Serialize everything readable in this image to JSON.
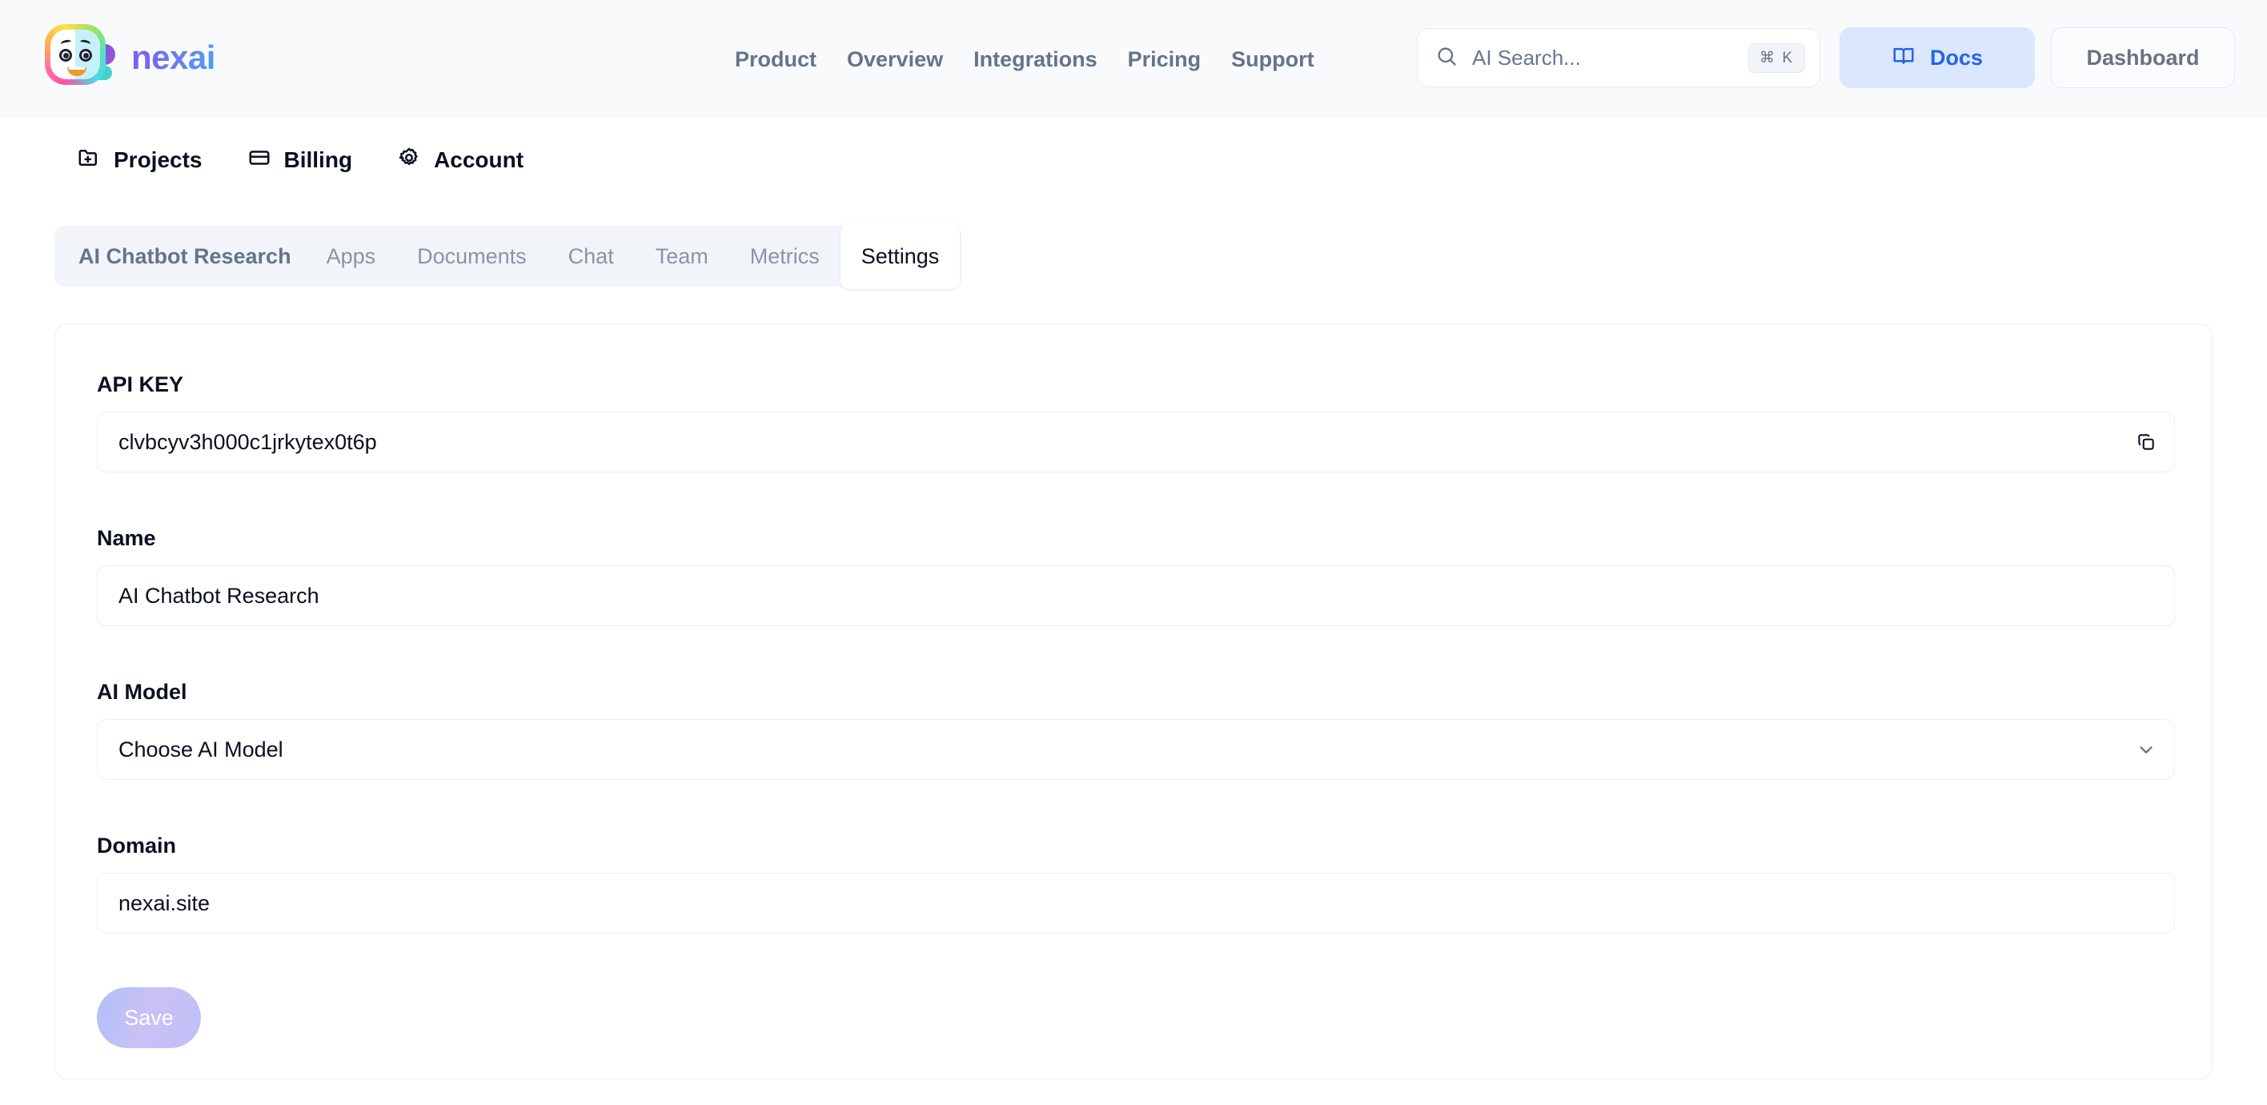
{
  "header": {
    "brand_name": "nexai",
    "nav_links": [
      "Product",
      "Overview",
      "Integrations",
      "Pricing",
      "Support"
    ],
    "search": {
      "placeholder": "AI Search...",
      "shortcut": "⌘ K"
    },
    "docs_label": "Docs",
    "dashboard_label": "Dashboard",
    "accent_blue": "#2563eb",
    "docs_bg": "#dbe7fd",
    "bar_bg": "#f8fafc"
  },
  "subnav": {
    "items": [
      {
        "label": "Projects",
        "icon": "folder-plus-icon"
      },
      {
        "label": "Billing",
        "icon": "credit-card-icon"
      },
      {
        "label": "Account",
        "icon": "gear-icon"
      }
    ]
  },
  "tabs": {
    "project_title": "AI Chatbot Research",
    "items": [
      "Apps",
      "Documents",
      "Chat",
      "Team",
      "Metrics",
      "Settings"
    ],
    "active": "Settings",
    "strip_bg": "#f1f5fa"
  },
  "settings_form": {
    "fields": [
      {
        "key": "api_key",
        "label": "API KEY",
        "value": "clvbcyv3h000c1jrkytex0t6p",
        "trailing_icon": "copy-icon"
      },
      {
        "key": "name",
        "label": "Name",
        "value": "AI Chatbot Research",
        "trailing_icon": ""
      },
      {
        "key": "ai_model",
        "label": "AI Model",
        "value": "Choose AI Model",
        "trailing_icon": "chevron-down-icon"
      },
      {
        "key": "domain",
        "label": "Domain",
        "value": "nexai.site",
        "trailing_icon": ""
      }
    ],
    "save_label": "Save"
  }
}
